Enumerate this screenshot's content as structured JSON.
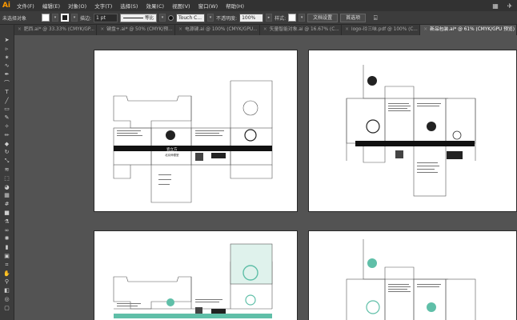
{
  "app": {
    "logo": "Ai"
  },
  "menu": [
    "文件(F)",
    "编辑(E)",
    "对象(O)",
    "文字(T)",
    "选择(S)",
    "效果(C)",
    "视图(V)",
    "窗口(W)",
    "帮助(H)"
  ],
  "control_bar": {
    "selection_status": "未选择对象",
    "stroke_label": "描边:",
    "stroke_weight": "1 pt",
    "stroke_profile": "等比",
    "brush": "Touch C...",
    "opacity_label": "不透明度:",
    "opacity_value": "100%",
    "style_label": "样式:",
    "doc_setup_button": "文档设置",
    "preferences_button": "首选项"
  },
  "tabs": [
    {
      "label": "肥西.ai* @ 33.33% (CMYK/GP...",
      "active": false
    },
    {
      "label": "键盘+.ai* @ 50% (CMYK/预...",
      "active": false
    },
    {
      "label": "电源键.ai @ 100% (CMYK/GPU...",
      "active": false
    },
    {
      "label": "矢量智能对象.ai @ 16.67% (C...",
      "active": false
    },
    {
      "label": "logo-玲三味.pdf @ 100% (C...",
      "active": false
    },
    {
      "label": "新品包装.ai* @ 61% (CMYK/GPU 预览)",
      "active": true
    }
  ],
  "tools": [
    "selection-tool",
    "direct-selection-tool",
    "magic-wand-tool",
    "lasso-tool",
    "pen-tool",
    "curvature-tool",
    "type-tool",
    "line-tool",
    "rectangle-tool",
    "paintbrush-tool",
    "shaper-tool",
    "pencil-tool",
    "eraser-tool",
    "rotate-tool",
    "scale-tool",
    "width-tool",
    "free-transform-tool",
    "shape-builder-tool",
    "perspective-tool",
    "mesh-tool",
    "gradient-tool",
    "eyedropper-tool",
    "blend-tool",
    "symbol-sprayer-tool",
    "graph-tool",
    "artboard-tool",
    "slice-tool",
    "hand-tool",
    "zoom-tool",
    "fill-stroke",
    "drawing-modes",
    "screen-mode"
  ],
  "tool_glyphs": [
    "➤",
    "▹",
    "✶",
    "∿",
    "✒",
    "⌒",
    "T",
    "╱",
    "▭",
    "✎",
    "✧",
    "✏",
    "◆",
    "↻",
    "⤡",
    "≋",
    "⬚",
    "◕",
    "▦",
    "#",
    "■",
    "⚗",
    "∞",
    "✺",
    "▮",
    "▣",
    "⌗",
    "✋",
    "⚲",
    "◧",
    "◎",
    "▢"
  ],
  "package_label": "瓷立方",
  "package_sub_label": "北京师德堂",
  "accent_colors": {
    "dark": "#111111",
    "teal": "#5fbfa8",
    "cut_line": "#e06060"
  }
}
